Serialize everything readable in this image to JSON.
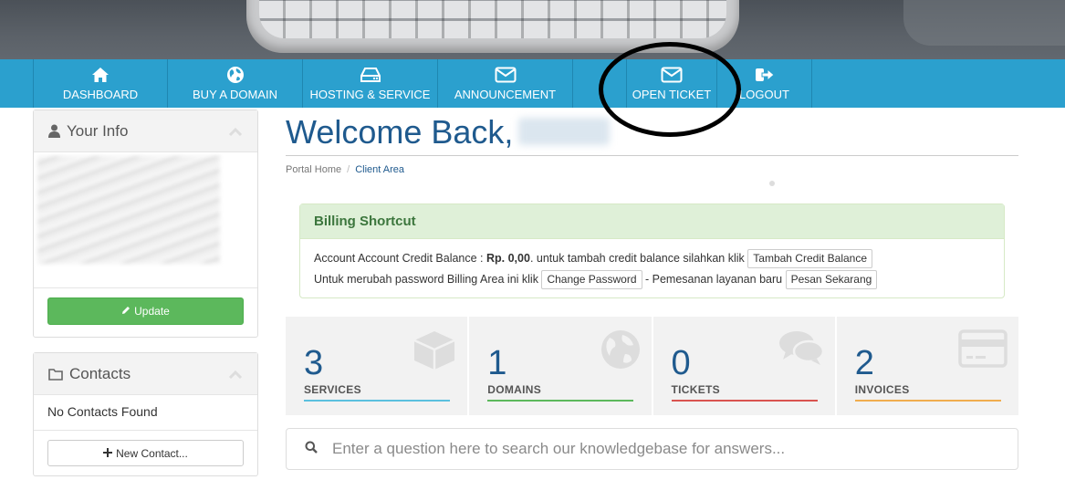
{
  "nav": {
    "items": [
      {
        "label": "DASHBOARD",
        "icon": "home-icon"
      },
      {
        "label": "BUY A DOMAIN",
        "icon": "globe-icon"
      },
      {
        "label": "HOSTING & SERVICE",
        "icon": "hdd-icon"
      },
      {
        "label": "ANNOUNCEMENT",
        "icon": "envelope-icon"
      },
      {
        "label": "",
        "icon": ""
      },
      {
        "label": "OPEN TICKET",
        "icon": "envelope-icon"
      },
      {
        "label": "LOGOUT",
        "icon": "sign-out-icon"
      }
    ]
  },
  "sidebar": {
    "your_info": {
      "title": "Your Info",
      "update_label": "Update"
    },
    "contacts": {
      "title": "Contacts",
      "empty_text": "No Contacts Found",
      "new_contact_label": "New Contact..."
    }
  },
  "main": {
    "welcome": "Welcome Back,",
    "breadcrumb": {
      "home": "Portal Home",
      "separator": "/",
      "current": "Client Area"
    },
    "billing": {
      "title": "Billing Shortcut",
      "line1_prefix": "Account Account Credit Balance : ",
      "balance": "Rp. 0,00",
      "line1_suffix": ". untuk tambah credit balance silahkan klik",
      "add_credit_label": "Tambah Credit Balance",
      "line2_prefix": "Untuk merubah password Billing Area ini klik",
      "change_password_label": "Change Password",
      "line2_mid": "- Pemesanan layanan baru",
      "order_now_label": "Pesan Sekarang"
    },
    "stats": [
      {
        "value": "3",
        "label": "SERVICES",
        "color": "#5bc0de",
        "icon": "cube-icon"
      },
      {
        "value": "1",
        "label": "DOMAINS",
        "color": "#5cb85c",
        "icon": "globe-icon"
      },
      {
        "value": "0",
        "label": "TICKETS",
        "color": "#d9534f",
        "icon": "comments-icon"
      },
      {
        "value": "2",
        "label": "INVOICES",
        "color": "#f0ad4e",
        "icon": "credit-card-icon"
      }
    ],
    "search": {
      "placeholder": "Enter a question here to search our knowledgebase for answers..."
    }
  },
  "colors": {
    "nav_bg": "#2ba0ce",
    "title": "#1f5a8e",
    "success": "#5cb85c"
  }
}
